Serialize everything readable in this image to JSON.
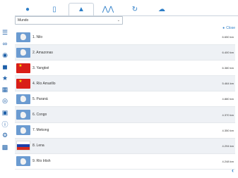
{
  "tabs": [
    {
      "name": "globe-icon"
    },
    {
      "name": "tablet-icon"
    },
    {
      "name": "water-drop-icon",
      "active": true
    },
    {
      "name": "mountains-icon"
    },
    {
      "name": "repeat-icon"
    },
    {
      "name": "cloud-icon"
    }
  ],
  "sidebar_icons": [
    "list-icon",
    "glasses-icon",
    "globe-africa-icon",
    "cube-icon",
    "star-icon",
    "table-icon",
    "compass-icon",
    "camera-icon",
    "info-icon",
    "gear-icon",
    "grid-icon"
  ],
  "region_select": {
    "value": "Mundo"
  },
  "close_label": "Close",
  "rivers": [
    {
      "label": "1. Nilo",
      "length": "6.650 km",
      "thumb": "map"
    },
    {
      "label": "2. Amazonas",
      "length": "6.400 km",
      "thumb": "map"
    },
    {
      "label": "3. Yangtsé",
      "length": "6.380 km",
      "thumb": "china"
    },
    {
      "label": "4. Río Amarillo",
      "length": "5.464 km",
      "thumb": "china"
    },
    {
      "label": "5. Paraná",
      "length": "4.880 km",
      "thumb": "map"
    },
    {
      "label": "6. Congo",
      "length": "4.370 km",
      "thumb": "map"
    },
    {
      "label": "7. Mekong",
      "length": "4.350 km",
      "thumb": "map"
    },
    {
      "label": "8. Lena",
      "length": "4.294 km",
      "thumb": "russia"
    },
    {
      "label": "9. Río Irtish",
      "length": "4.248 km",
      "thumb": "map"
    }
  ],
  "colors": {
    "accent": "#2f7fc8",
    "sidebar": "#1d5fa8",
    "row_alt": "#eef1f5"
  }
}
